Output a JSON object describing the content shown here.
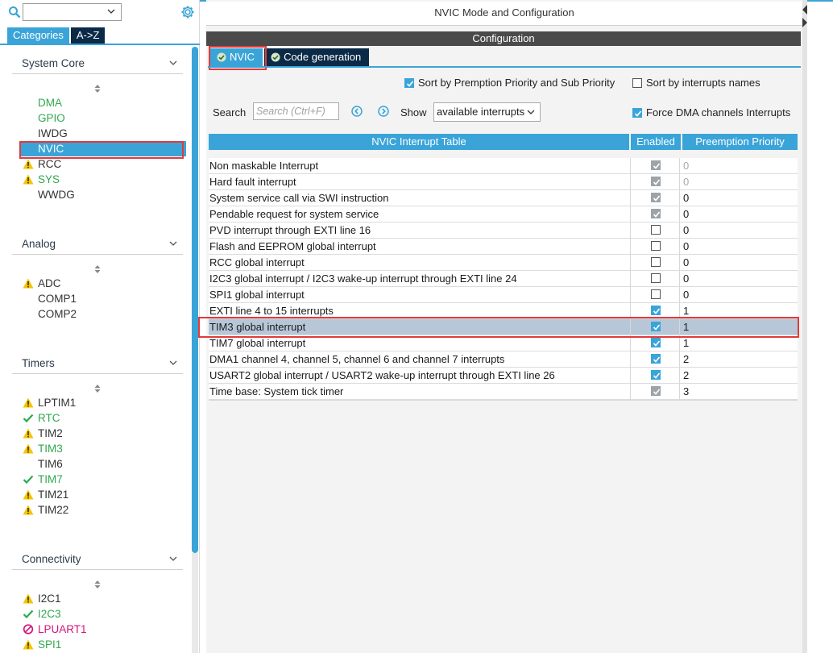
{
  "left_panel": {
    "search_value": "",
    "tabs": {
      "categories": "Categories",
      "az": "A->Z"
    },
    "groups": [
      {
        "title": "System Core",
        "items": [
          {
            "label": "DMA",
            "status": "green"
          },
          {
            "label": "GPIO",
            "status": "green"
          },
          {
            "label": "IWDG",
            "status": "dark"
          },
          {
            "label": "NVIC",
            "status": "selected"
          },
          {
            "label": "RCC",
            "status": "warning"
          },
          {
            "label": "SYS",
            "status": "warning-green"
          },
          {
            "label": "WWDG",
            "status": "dark"
          }
        ]
      },
      {
        "title": "Analog",
        "items": [
          {
            "label": "ADC",
            "status": "warning"
          },
          {
            "label": "COMP1",
            "status": "dark"
          },
          {
            "label": "COMP2",
            "status": "dark"
          }
        ]
      },
      {
        "title": "Timers",
        "items": [
          {
            "label": "LPTIM1",
            "status": "warning"
          },
          {
            "label": "RTC",
            "status": "check"
          },
          {
            "label": "TIM2",
            "status": "warning"
          },
          {
            "label": "TIM3",
            "status": "warning-green"
          },
          {
            "label": "TIM6",
            "status": "dark"
          },
          {
            "label": "TIM7",
            "status": "check"
          },
          {
            "label": "TIM21",
            "status": "warning"
          },
          {
            "label": "TIM22",
            "status": "warning"
          }
        ]
      },
      {
        "title": "Connectivity",
        "items": [
          {
            "label": "I2C1",
            "status": "warning"
          },
          {
            "label": "I2C3",
            "status": "check"
          },
          {
            "label": "LPUART1",
            "status": "disabled"
          },
          {
            "label": "SPI1",
            "status": "warning-green"
          }
        ]
      }
    ]
  },
  "right_panel": {
    "window_title": "NVIC Mode and Configuration",
    "config_title": "Configuration",
    "tabs": {
      "nvic": "NVIC",
      "codegen": "Code generation"
    },
    "options": {
      "sort_priority": {
        "label": "Sort by Premption Priority and Sub Priority",
        "checked": true
      },
      "sort_names": {
        "label": "Sort by interrupts names",
        "checked": false
      },
      "force_dma": {
        "label": "Force DMA channels Interrupts",
        "checked": true
      }
    },
    "search": {
      "label": "Search",
      "placeholder": "Search (Ctrl+F)"
    },
    "show": {
      "label": "Show",
      "value": "available interrupts"
    },
    "table": {
      "headers": {
        "name": "NVIC Interrupt Table",
        "enabled": "Enabled",
        "priority": "Preemption Priority"
      },
      "rows": [
        {
          "name": "Non maskable Interrupt",
          "enabled": "locked",
          "priority": "0",
          "dim": true
        },
        {
          "name": "Hard fault interrupt",
          "enabled": "locked",
          "priority": "0",
          "dim": true
        },
        {
          "name": "System service call via SWI instruction",
          "enabled": "locked",
          "priority": "0"
        },
        {
          "name": "Pendable request for system service",
          "enabled": "locked",
          "priority": "0"
        },
        {
          "name": "PVD interrupt through EXTI line 16",
          "enabled": "off",
          "priority": "0"
        },
        {
          "name": "Flash and EEPROM global interrupt",
          "enabled": "off",
          "priority": "0"
        },
        {
          "name": "RCC global interrupt",
          "enabled": "off",
          "priority": "0"
        },
        {
          "name": "I2C3 global interrupt / I2C3 wake-up interrupt through EXTI line 24",
          "enabled": "off",
          "priority": "0"
        },
        {
          "name": "SPI1 global interrupt",
          "enabled": "off",
          "priority": "0"
        },
        {
          "name": "EXTI line 4 to 15 interrupts",
          "enabled": "on",
          "priority": "1"
        },
        {
          "name": "TIM3 global interrupt",
          "enabled": "on",
          "priority": "1",
          "selected": true
        },
        {
          "name": "TIM7 global interrupt",
          "enabled": "on",
          "priority": "1"
        },
        {
          "name": "DMA1 channel 4, channel 5, channel 6 and channel 7 interrupts",
          "enabled": "on",
          "priority": "2"
        },
        {
          "name": "USART2 global interrupt / USART2 wake-up interrupt through EXTI line 26",
          "enabled": "on",
          "priority": "2"
        },
        {
          "name": "Time base: System tick timer",
          "enabled": "locked",
          "priority": "3"
        }
      ]
    }
  },
  "colors": {
    "accent": "#3aa4d8",
    "dark_tab": "#0b2a47",
    "green": "#2fa84f",
    "warning": "#f5c400",
    "magenta": "#d4147a",
    "highlight_box": "#e23a3a"
  }
}
